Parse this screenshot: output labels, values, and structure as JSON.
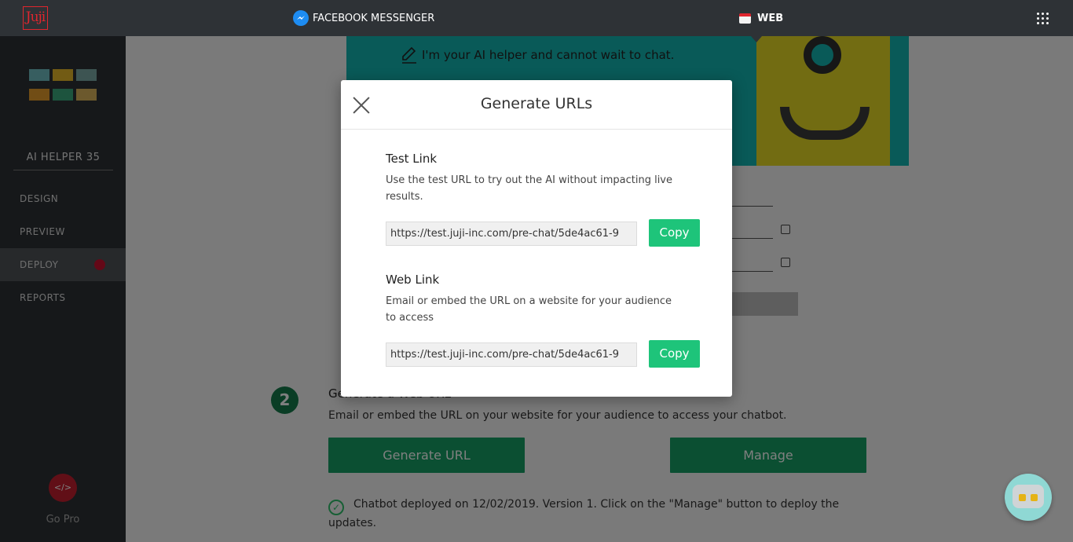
{
  "topbar": {
    "logo": "Juji",
    "tab_facebook": "FACEBOOK MESSENGER",
    "tab_web": "WEB"
  },
  "sidebar": {
    "bot_name": "AI HELPER 35",
    "items": [
      {
        "label": "DESIGN"
      },
      {
        "label": "PREVIEW"
      },
      {
        "label": "DEPLOY"
      },
      {
        "label": "REPORTS"
      }
    ],
    "gopro_icon": "</>",
    "gopro_label": "Go Pro",
    "avatar_colors": [
      "#6fbcc0",
      "#e4b628",
      "#7aa9a4",
      "#e39a2a",
      "#3ba97c",
      "#d9b35a"
    ]
  },
  "main": {
    "hero_message": "I'm your AI helper and cannot wait to chat.",
    "step_number": "2",
    "step_title": "Generate a Web URL",
    "step_desc": "Email or embed the URL on your website for your audience to access your chatbot.",
    "generate_button": "Generate URL",
    "manage_button": "Manage",
    "deployed_text": "Chatbot deployed on 12/02/2019. Version 1. Click on the \"Manage\" button to deploy the updates."
  },
  "modal": {
    "title": "Generate URLs",
    "test": {
      "title": "Test Link",
      "desc": "Use the test URL to try out the AI without impacting live results.",
      "url": "https://test.juji-inc.com/pre-chat/5de4ac61-9",
      "copy": "Copy"
    },
    "web": {
      "title": "Web Link",
      "desc": "Email or embed the URL on a website for your audience to access",
      "url": "https://test.juji-inc.com/pre-chat/5de4ac61-9",
      "copy": "Copy"
    }
  },
  "colors": {
    "accent_green": "#1ec47a",
    "dark_green": "#169e64",
    "brand_red": "#e0262e",
    "teal": "#12b5b0"
  }
}
